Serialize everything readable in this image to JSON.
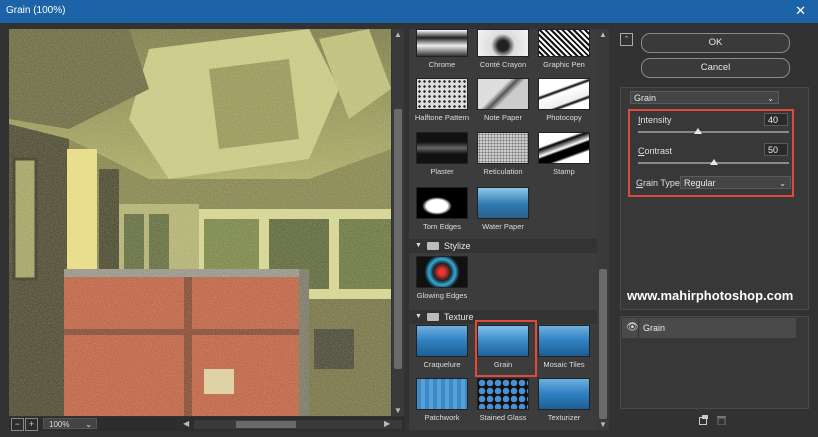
{
  "window": {
    "title": "Grain (100%)",
    "close_glyph": "✕"
  },
  "preview": {
    "zoom": "100%"
  },
  "gallery": {
    "artistic_row1": [
      {
        "label": "Chrome",
        "icon": "chrome-thumbnail"
      },
      {
        "label": "Conté Crayon",
        "icon": "conte-crayon-thumbnail"
      },
      {
        "label": "Graphic Pen",
        "icon": "graphic-pen-thumbnail"
      }
    ],
    "artistic_row2": [
      {
        "label": "Halftone Pattern",
        "icon": "halftone-pattern-thumbnail"
      },
      {
        "label": "Note Paper",
        "icon": "note-paper-thumbnail"
      },
      {
        "label": "Photocopy",
        "icon": "photocopy-thumbnail"
      }
    ],
    "artistic_row3": [
      {
        "label": "Plaster",
        "icon": "plaster-thumbnail"
      },
      {
        "label": "Reticulation",
        "icon": "reticulation-thumbnail"
      },
      {
        "label": "Stamp",
        "icon": "stamp-thumbnail"
      }
    ],
    "artistic_row4": [
      {
        "label": "Torn Edges",
        "icon": "torn-edges-thumbnail"
      },
      {
        "label": "Water Paper",
        "icon": "water-paper-thumbnail"
      }
    ],
    "stylize": {
      "label": "Stylize",
      "items": [
        {
          "label": "Glowing Edges"
        }
      ]
    },
    "texture": {
      "label": "Texture",
      "row1": [
        {
          "label": "Craquelure"
        },
        {
          "label": "Grain"
        },
        {
          "label": "Mosaic Tiles"
        }
      ],
      "row2": [
        {
          "label": "Patchwork"
        },
        {
          "label": "Stained Glass"
        },
        {
          "label": "Texturizer"
        }
      ],
      "selected": "Grain"
    }
  },
  "buttons": {
    "ok": "OK",
    "cancel": "Cancel"
  },
  "settings": {
    "filter": "Grain",
    "intensity": {
      "label_u": "I",
      "label_rest": "ntensity",
      "value": "40",
      "level": 0.4
    },
    "contrast": {
      "label_u": "C",
      "label_rest": "ontrast",
      "value": "50",
      "level": 0.5
    },
    "grain_type": {
      "label_u": "G",
      "label_rest": "rain Type:",
      "value": "Regular"
    }
  },
  "watermark": "www.mahirphotoshop.com",
  "layers": [
    {
      "name": "Grain",
      "visible": true
    }
  ],
  "colors": {
    "highlight": "#e04a3a",
    "titlebar": "#1d63a8"
  }
}
